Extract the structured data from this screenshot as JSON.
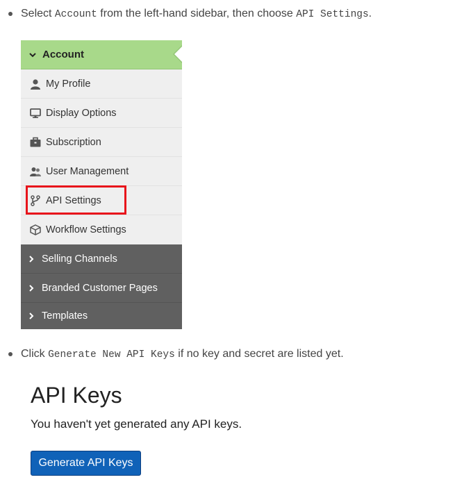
{
  "instructions": [
    {
      "pre": "Select ",
      "code1": "Account",
      "mid": " from the left-hand sidebar, then choose ",
      "code2": "API Settings",
      "post": "."
    },
    {
      "pre": "Click ",
      "code1": "Generate New API Keys",
      "post": " if no key and secret are listed yet."
    }
  ],
  "sidebar": {
    "header": {
      "label": "Account",
      "icon": "chevron-down-icon"
    },
    "items": [
      {
        "label": "My Profile",
        "icon": "user-icon"
      },
      {
        "label": "Display Options",
        "icon": "monitor-icon"
      },
      {
        "label": "Subscription",
        "icon": "briefcase-icon"
      },
      {
        "label": "User Management",
        "icon": "users-icon"
      },
      {
        "label": "API Settings",
        "icon": "branch-icon",
        "highlighted": true
      },
      {
        "label": "Workflow Settings",
        "icon": "cube-icon"
      }
    ],
    "sections": [
      {
        "label": "Selling Channels"
      },
      {
        "label": "Branded Customer Pages"
      },
      {
        "label": "Templates"
      }
    ],
    "colors": {
      "active": "#a8d98a",
      "dark": "#606060",
      "highlight": "#e8141b"
    }
  },
  "api_keys": {
    "title": "API Keys",
    "description": "You haven't yet generated any API keys.",
    "button_label": "Generate API Keys",
    "button_color": "#1062b8"
  }
}
